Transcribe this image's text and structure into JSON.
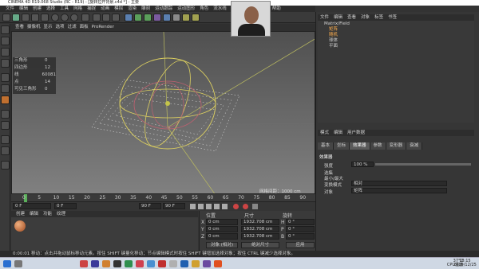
{
  "window": {
    "title": "CINEMA 4D R19.068 Studio (RC - R19) - [旋转拉开背景.c4d *] - 主要"
  },
  "menubar": [
    "文件",
    "编辑",
    "创建",
    "选择",
    "工具",
    "网格",
    "捕捉",
    "动画",
    "模拟",
    "渲染",
    "雕刻",
    "运动跟踪",
    "运动图形",
    "角色",
    "流水线",
    "插件",
    "脚本",
    "窗口",
    "帮助"
  ],
  "viewport": {
    "menu": [
      "查看",
      "摄像机",
      "显示",
      "选项",
      "过滤",
      "面板",
      "ProRender"
    ],
    "info": [
      {
        "k": "三角形",
        "v": "0"
      },
      {
        "k": "四边形",
        "v": "12"
      },
      {
        "k": "线",
        "v": "60081"
      },
      {
        "k": "点",
        "v": "14"
      },
      {
        "k": "可见三角形",
        "v": "0"
      }
    ],
    "grid_scale": "网格间距：1000 cm"
  },
  "timeline": {
    "ticks": [
      "0",
      "5",
      "10",
      "15",
      "20",
      "25",
      "30",
      "35",
      "40",
      "45",
      "50",
      "55",
      "60",
      "65",
      "70",
      "75",
      "80",
      "85",
      "90"
    ],
    "frame_field": "0 F",
    "start_field": "0 F",
    "end_field": "90 F",
    "end_field2": "90 F",
    "current_frame": "0 F"
  },
  "material": {
    "menu": [
      "创建",
      "编辑",
      "功能",
      "纹理"
    ]
  },
  "coords": {
    "headers": [
      "位置",
      "尺寸",
      "旋转"
    ],
    "rows": [
      {
        "axis": "X",
        "pos": "0 cm",
        "size": "1932.708 cm",
        "rot_axis": "H",
        "rot": "0 °"
      },
      {
        "axis": "Y",
        "pos": "0 cm",
        "size": "1932.708 cm",
        "rot_axis": "P",
        "rot": "0 °"
      },
      {
        "axis": "Z",
        "pos": "0 cm",
        "size": "1932.708 cm",
        "rot_axis": "B",
        "rot": "0 °"
      }
    ],
    "mode": "对象 (相对)",
    "size_mode": "绝对尺寸",
    "apply": "应用"
  },
  "status": "0:00:01 移动：点击并拖动鼠标移动元素。按住 SHIFT 键量化移动；节点编辑模式时按住 SHIFT 键增加选择对象；按住 CTRL 键减少选择对象。",
  "objects": {
    "menu": [
      "文件",
      "编辑",
      "查看",
      "对象",
      "标签",
      "书签"
    ],
    "items": [
      "Matrix/Field",
      "矩阵",
      "随机",
      "球体",
      "平面"
    ]
  },
  "attributes": {
    "menu": [
      "模式",
      "编辑",
      "用户数据"
    ],
    "tabs": [
      "基本",
      "坐标",
      "效果器",
      "参数",
      "变形器",
      "衰减"
    ],
    "title": "效果器",
    "strength_label": "强度",
    "strength_value": "100 %",
    "selection_label": "选集",
    "mode_label": "最小/最大",
    "blend_label": "变换模式",
    "blend_value": "相对",
    "target_label": "对象",
    "target_value": "矩阵"
  },
  "tray": {
    "time": "18:15",
    "date": "2019/12/25",
    "temp": "37°C",
    "weather": "CPU温度"
  }
}
